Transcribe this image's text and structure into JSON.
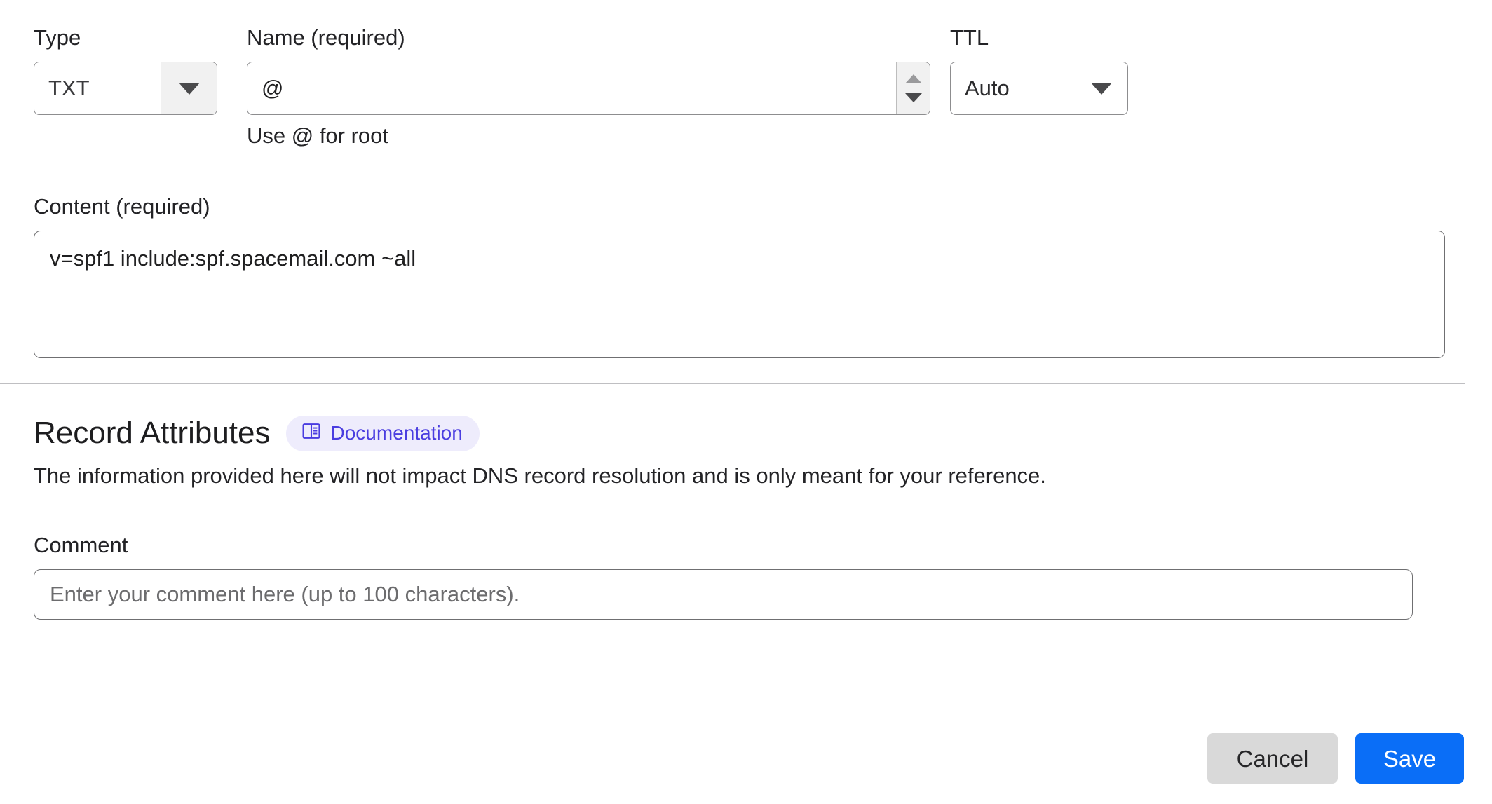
{
  "form": {
    "type": {
      "label": "Type",
      "value": "TXT",
      "caret_icon": "chevron-down-icon"
    },
    "name": {
      "label": "Name (required)",
      "value": "@",
      "placeholder": "",
      "helper": "Use @ for root",
      "spinner_up_icon": "spinner-up-arrow-icon",
      "spinner_down_icon": "spinner-down-arrow-icon"
    },
    "ttl": {
      "label": "TTL",
      "value": "Auto",
      "caret_icon": "chevron-down-icon"
    },
    "content": {
      "label": "Content (required)",
      "value": "v=spf1 include:spf.spacemail.com ~all",
      "placeholder": ""
    }
  },
  "record_attributes": {
    "title": "Record Attributes",
    "documentation_label": "Documentation",
    "documentation_icon": "book-icon",
    "description": "The information provided here will not impact DNS record resolution and is only meant for your reference.",
    "comment": {
      "label": "Comment",
      "value": "",
      "placeholder": "Enter your comment here (up to 100 characters)."
    }
  },
  "footer": {
    "cancel_label": "Cancel",
    "save_label": "Save"
  },
  "colors": {
    "accent_blue": "#0a6ef7",
    "cancel_gray": "#d9d9d9",
    "doc_pill_bg": "#eeecfc",
    "doc_pill_text": "#4a3de0",
    "border_gray": "#8d8d8f",
    "divider_gray": "#bfbfc2"
  }
}
